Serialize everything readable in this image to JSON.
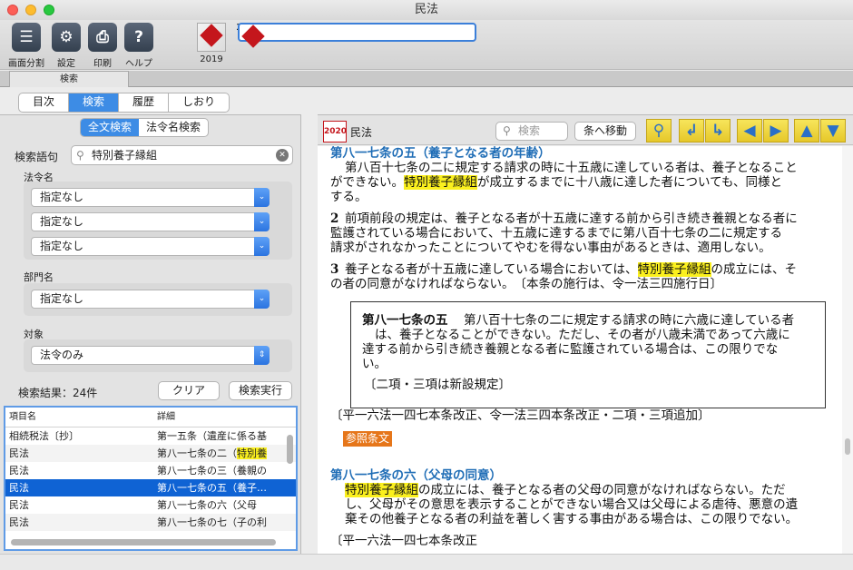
{
  "window": {
    "title": "民法"
  },
  "toolbar": {
    "split": "画面分割",
    "settings": "設定",
    "print": "印刷",
    "help": "ヘルプ",
    "book2019": "2019",
    "book2020": "2020"
  },
  "tabstrip": {
    "tab": "検索"
  },
  "nav": {
    "tabs": [
      "目次",
      "検索",
      "履歴",
      "しおり"
    ]
  },
  "left": {
    "modes": [
      "全文検索",
      "法令名検索"
    ],
    "query_label": "検索語句",
    "query_value": "特別養子縁組",
    "law_label": "法令名",
    "law_selects": [
      "指定なし",
      "指定なし",
      "指定なし"
    ],
    "dept_label": "部門名",
    "dept_select": "指定なし",
    "target_label": "対象",
    "target_select": "法令のみ",
    "result_count": "検索結果：24件",
    "clear": "クリア",
    "execute": "検索実行",
    "columns": [
      "項目名",
      "詳細"
    ],
    "rows": [
      {
        "name": "相続税法〔抄〕",
        "detail": "第一五条（遺産に係る基"
      },
      {
        "name": "民法",
        "detail_pre": "第八一七条の二（",
        "detail_hl": "特別養"
      },
      {
        "name": "民法",
        "detail": "第八一七条の三（養親の"
      },
      {
        "name": "民法",
        "detail": "第八一七条の五（養子…"
      },
      {
        "name": "民法",
        "detail": "第八一七条の六（父母"
      },
      {
        "name": "民法",
        "detail": "第八一七条の七（子の利"
      }
    ]
  },
  "right": {
    "badge": "2020",
    "law_name": "民法",
    "search_placeholder": "検索",
    "goto": "条へ移動",
    "buttons": [
      "search-icon",
      "return-left-icon",
      "return-right-icon",
      "prev-icon",
      "next-icon",
      "up-icon",
      "down-icon"
    ]
  },
  "doc": {
    "a1_title": "第八一七条の五（養子となる者の年齢）",
    "a1_l1": "第八百十七条の二に規定する請求の時に十五歳に達している者は、養子となること",
    "a1_l2_pre": "ができない。",
    "hl": "特別養子縁組",
    "a1_l2_post": "が成立するまでに十八歳に達した者についても、同様と",
    "a1_l3": "する。",
    "p2_num": "2",
    "p2_l1": "前項前段の規定は、養子となる者が十五歳に達する前から引き続き養親となる者に",
    "p2_l2": "監護されている場合において、十五歳に達するまでに第八百十七条の二に規定する",
    "p2_l3": "請求がされなかったことについてやむを得ない事由があるときは、適用しない。",
    "p3_num": "3",
    "p3_l1_pre": "養子となる者が十五歳に達している場合においては、",
    "p3_l1_post": "の成立には、そ",
    "p3_l2": "の者の同意がなければならない。　〔本条の施行は、令一法三四施行日〕",
    "box_title": "第八一七条の五",
    "box_l1": "第八百十七条の二に規定する請求の時に六歳に達している者",
    "box_l2": "は、養子となることができない。ただし、その者が八歳未満であって六歳に",
    "box_l3": "達する前から引き続き養親となる者に監護されている場合は、この限りでな",
    "box_l4": "い。",
    "box_note": "〔二項・三項は新設規定〕",
    "amend1": "〔平一六法一四七本条改正、令一法三四本条改正・二項・三項追加〕",
    "ref": "参照条文",
    "a2_title": "第八一七条の六（父母の同意）",
    "a2_l1_post": "の成立には、養子となる者の父母の同意がなければならない。ただ",
    "a2_l2": "し、父母がその意思を表示することができない場合又は父母による虐待、悪意の遺",
    "a2_l3": "棄その他養子となる者の利益を著しく害する事由がある場合は、この限りでない。",
    "amend2": "〔平一六法一四七本条改正"
  }
}
